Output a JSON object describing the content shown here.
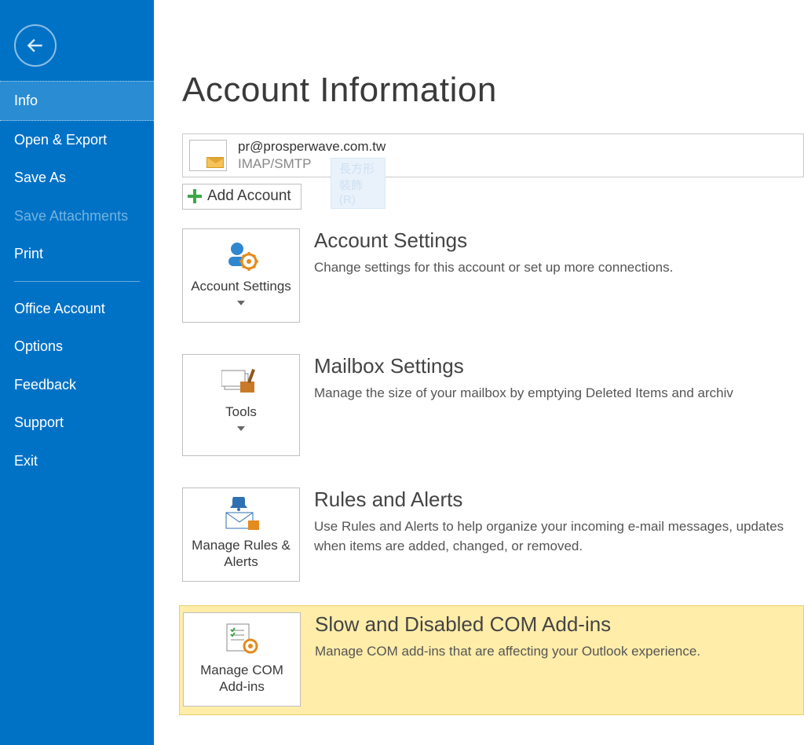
{
  "sidebar": {
    "items": [
      {
        "label": "Info",
        "state": "selected"
      },
      {
        "label": "Open & Export",
        "state": ""
      },
      {
        "label": "Save As",
        "state": ""
      },
      {
        "label": "Save Attachments",
        "state": "disabled"
      },
      {
        "label": "Print",
        "state": ""
      }
    ],
    "lowerItems": [
      {
        "label": "Office Account"
      },
      {
        "label": "Options"
      },
      {
        "label": "Feedback"
      },
      {
        "label": "Support"
      },
      {
        "label": "Exit"
      }
    ]
  },
  "page": {
    "title": "Account Information"
  },
  "account": {
    "email": "pr@prosperwave.com.tw",
    "protocol": "IMAP/SMTP",
    "ghostText": "長方形裝飾(R)"
  },
  "addAccount": {
    "label": "Add Account"
  },
  "sections": {
    "accountSettings": {
      "tile": "Account Settings",
      "title": "Account Settings",
      "desc": "Change settings for this account or set up more connections."
    },
    "mailbox": {
      "tile": "Tools",
      "title": "Mailbox Settings",
      "desc": "Manage the size of your mailbox by emptying Deleted Items and archiv"
    },
    "rules": {
      "tile": "Manage Rules & Alerts",
      "title": "Rules and Alerts",
      "desc": "Use Rules and Alerts to help organize your incoming e-mail messages, updates when items are added, changed, or removed."
    },
    "addins": {
      "tile": "Manage COM Add-ins",
      "title": "Slow and Disabled COM Add-ins",
      "desc": "Manage COM add-ins that are affecting your Outlook experience."
    }
  }
}
